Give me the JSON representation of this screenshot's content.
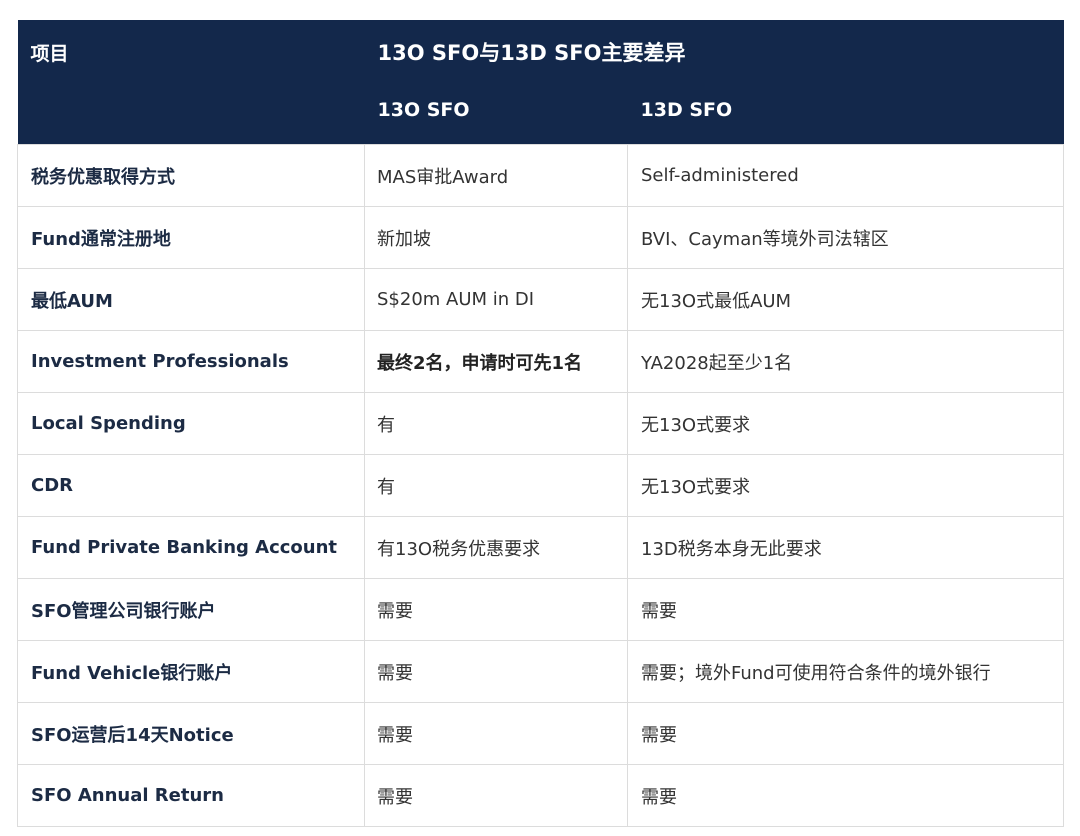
{
  "header": {
    "item_label": "项目",
    "title": "13O SFO与13D SFO主要差异",
    "col_13o": "13O SFO",
    "col_13d": "13D SFO"
  },
  "rows": [
    {
      "item": "税务优惠取得方式",
      "o13": "MAS审批Award",
      "d13": "Self-administered"
    },
    {
      "item": "Fund通常注册地",
      "o13": "新加坡",
      "d13": "BVI、Cayman等境外司法辖区"
    },
    {
      "item": "最低AUM",
      "o13": "S$20m AUM in DI",
      "d13": "无13O式最低AUM"
    },
    {
      "item": "Investment Professionals",
      "o13": "最终2名，申请时可先1名",
      "d13": "YA2028起至少1名"
    },
    {
      "item": "Local Spending",
      "o13": "有",
      "d13": "无13O式要求"
    },
    {
      "item": "CDR",
      "o13": "有",
      "d13": "无13O式要求"
    },
    {
      "item": "Fund Private Banking Account",
      "o13": "有13O税务优惠要求",
      "d13": "13D税务本身无此要求"
    },
    {
      "item": "SFO管理公司银行账户",
      "o13": "需要",
      "d13": "需要"
    },
    {
      "item": "Fund Vehicle银行账户",
      "o13": "需要",
      "d13": "需要；境外Fund可使用符合条件的境外银行"
    },
    {
      "item": "SFO运营后14天Notice",
      "o13": "需要",
      "d13": "需要"
    },
    {
      "item": "SFO Annual Return",
      "o13": "需要",
      "d13": "需要"
    }
  ]
}
